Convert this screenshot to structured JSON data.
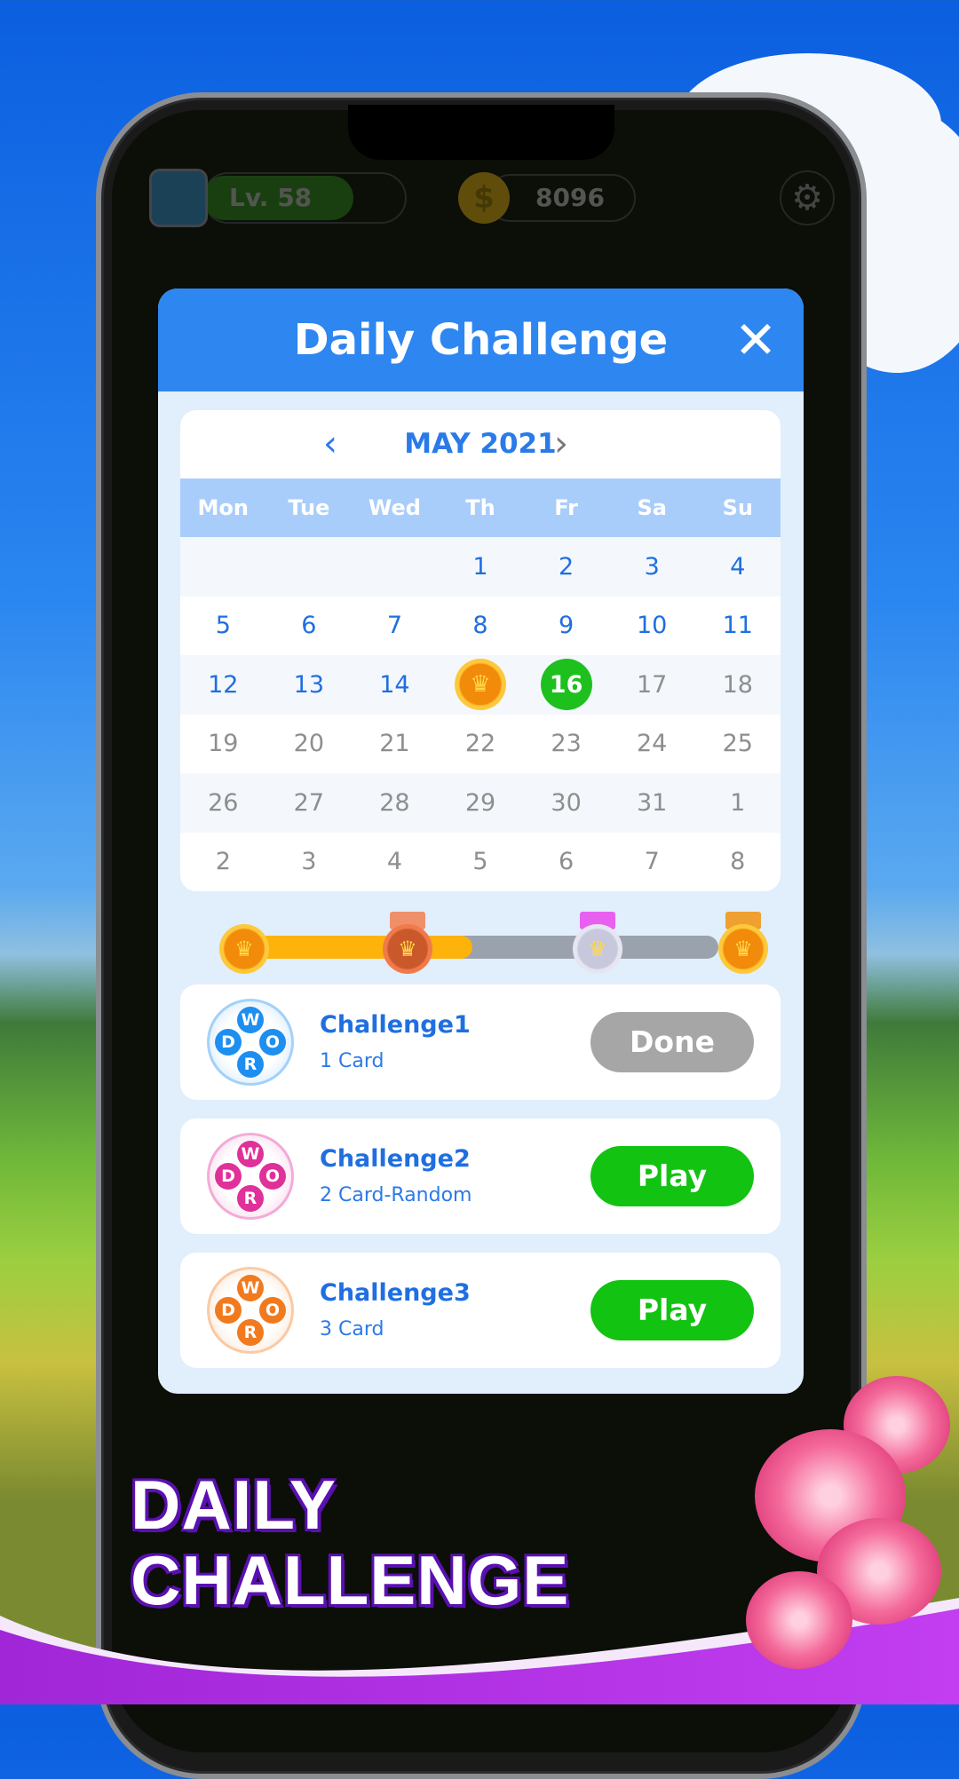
{
  "topbar": {
    "level": "Lv. 58",
    "coins": "8096",
    "coin_icon": "$",
    "plus": "+",
    "settings_icon": "⚙"
  },
  "modal": {
    "title": "Daily Challenge",
    "close": "✕"
  },
  "calendar": {
    "month": "MAY 2021",
    "prev": "‹",
    "next": "›",
    "weekdays": [
      "Mon",
      "Tue",
      "Wed",
      "Th",
      "Fr",
      "Sa",
      "Su"
    ],
    "weeks": [
      [
        {
          "d": "",
          "s": "other"
        },
        {
          "d": "",
          "s": "other"
        },
        {
          "d": "",
          "s": "other"
        },
        {
          "d": "1",
          "s": "past"
        },
        {
          "d": "2",
          "s": "past"
        },
        {
          "d": "3",
          "s": "past"
        },
        {
          "d": "4",
          "s": "past"
        }
      ],
      [
        {
          "d": "5",
          "s": "past"
        },
        {
          "d": "6",
          "s": "past"
        },
        {
          "d": "7",
          "s": "past"
        },
        {
          "d": "8",
          "s": "past"
        },
        {
          "d": "9",
          "s": "past"
        },
        {
          "d": "10",
          "s": "past"
        },
        {
          "d": "11",
          "s": "past"
        }
      ],
      [
        {
          "d": "12",
          "s": "past"
        },
        {
          "d": "13",
          "s": "past"
        },
        {
          "d": "14",
          "s": "past"
        },
        {
          "d": "♛",
          "s": "crown"
        },
        {
          "d": "16",
          "s": "today"
        },
        {
          "d": "17",
          "s": "future"
        },
        {
          "d": "18",
          "s": "future"
        }
      ],
      [
        {
          "d": "19",
          "s": "future"
        },
        {
          "d": "20",
          "s": "future"
        },
        {
          "d": "21",
          "s": "future"
        },
        {
          "d": "22",
          "s": "future"
        },
        {
          "d": "23",
          "s": "future"
        },
        {
          "d": "24",
          "s": "future"
        },
        {
          "d": "25",
          "s": "future"
        }
      ],
      [
        {
          "d": "26",
          "s": "future"
        },
        {
          "d": "27",
          "s": "future"
        },
        {
          "d": "28",
          "s": "future"
        },
        {
          "d": "29",
          "s": "future"
        },
        {
          "d": "30",
          "s": "future"
        },
        {
          "d": "31",
          "s": "future"
        },
        {
          "d": "1",
          "s": "other"
        }
      ],
      [
        {
          "d": "2",
          "s": "other"
        },
        {
          "d": "3",
          "s": "other"
        },
        {
          "d": "4",
          "s": "other"
        },
        {
          "d": "5",
          "s": "other"
        },
        {
          "d": "6",
          "s": "other"
        },
        {
          "d": "7",
          "s": "other"
        },
        {
          "d": "8",
          "s": "other"
        }
      ]
    ]
  },
  "progress": {
    "fill_percent": 48,
    "crown_icon": "♛",
    "medals": [
      "gold-crown",
      "bronze-medal",
      "silver-medal",
      "gold-medal"
    ]
  },
  "challenges": [
    {
      "name": "Challenge1",
      "sub": "1 Card",
      "button": "Done",
      "button_color": "#a6a6a6",
      "icon_color": "#1e8ef0",
      "letters": [
        "W",
        "D",
        "O",
        "R"
      ]
    },
    {
      "name": "Challenge2",
      "sub": "2 Card-Random",
      "button": "Play",
      "button_color": "#12c312",
      "icon_color": "#e0309a",
      "letters": [
        "W",
        "D",
        "O",
        "R"
      ]
    },
    {
      "name": "Challenge3",
      "sub": "3 Card",
      "button": "Play",
      "button_color": "#12c312",
      "icon_color": "#f27a1e",
      "letters": [
        "W",
        "D",
        "O",
        "R"
      ]
    }
  ],
  "banner": {
    "line1": "DAILY",
    "line2": "CHALLENGE"
  }
}
